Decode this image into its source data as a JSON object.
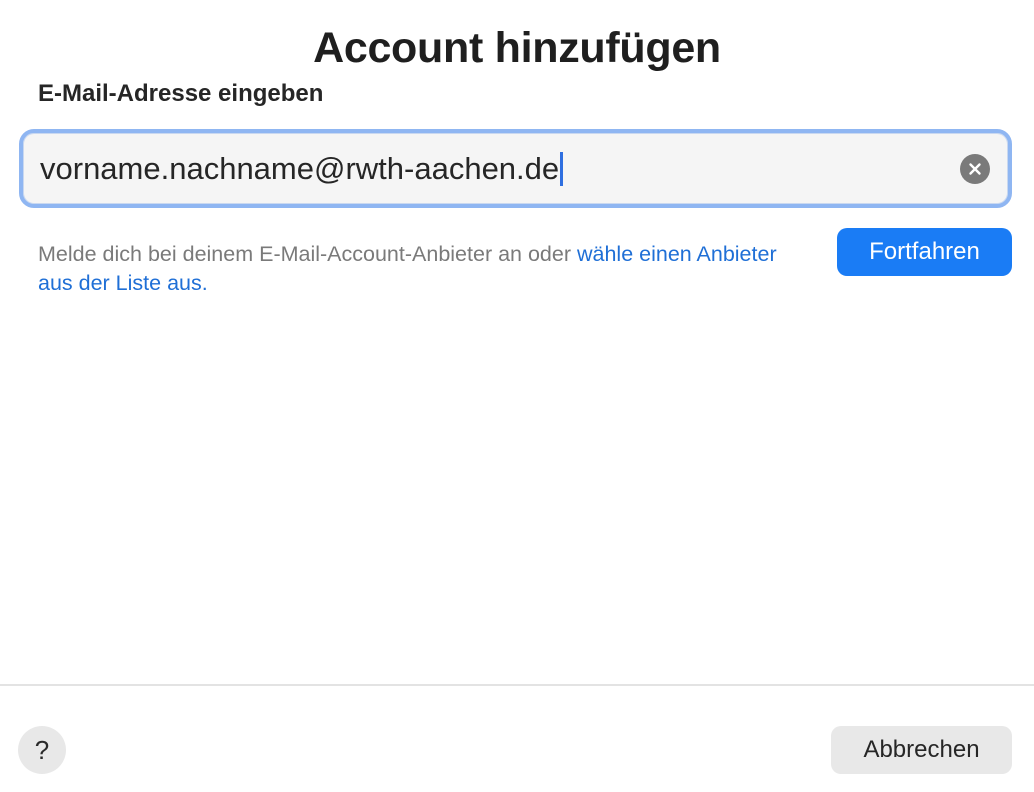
{
  "dialog": {
    "title": "Account hinzufügen"
  },
  "email": {
    "label": "E-Mail-Adresse eingeben",
    "value": "vorname.nachname@rwth-aachen.de",
    "clear_icon": "clear-circle-x-icon"
  },
  "hint": {
    "text": "Melde dich bei deinem E-Mail-Account-Anbieter an oder ",
    "link_text": "wähle einen Anbieter aus der Liste aus."
  },
  "buttons": {
    "continue_label": "Fortfahren",
    "help_label": "?",
    "cancel_label": "Abbrechen"
  },
  "colors": {
    "accent": "#1a7cf5",
    "link": "#1f6fd6",
    "focus_ring": "#8fb6f2"
  }
}
